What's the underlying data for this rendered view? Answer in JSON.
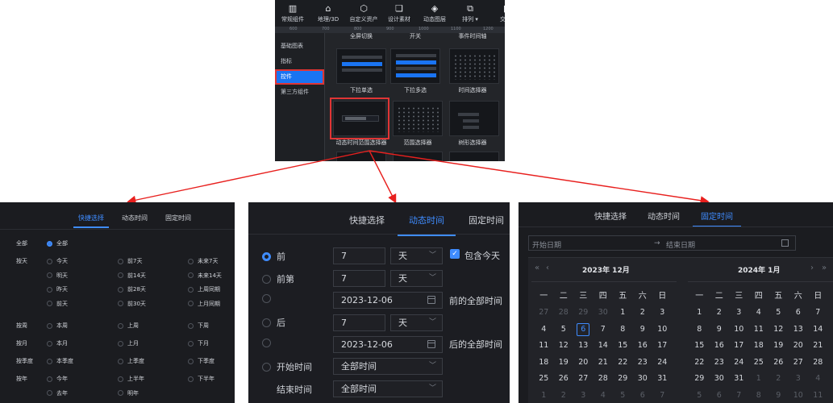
{
  "picker": {
    "toolbar": [
      {
        "label": "常规组件",
        "icon": "chart-icon",
        "glyph": "▥"
      },
      {
        "label": "地理/3D",
        "icon": "map-pin-icon",
        "glyph": "⌂"
      },
      {
        "label": "自定义资产",
        "icon": "hexagon-icon",
        "glyph": "⬡"
      },
      {
        "label": "设计素材",
        "icon": "puzzle-icon",
        "glyph": "❏"
      },
      {
        "label": "动态图层",
        "icon": "layers-icon",
        "glyph": "◈"
      },
      {
        "label": "排列 ▾",
        "icon": "arrange-icon",
        "glyph": "⧉"
      },
      {
        "label": "交互",
        "icon": "interaction-icon",
        "glyph": "▮"
      }
    ],
    "ruler": [
      "600",
      "700",
      "800",
      "900",
      "1000",
      "1100",
      "1200"
    ],
    "sidebar": [
      "基础图表",
      "指标",
      "控件",
      "第三方组件"
    ],
    "sidebar_active": "控件",
    "row1_labels": [
      "全屏切换",
      "开关",
      "事件时间轴"
    ],
    "row2_labels": [
      "下拉单选",
      "下拉多选",
      "时间选择器"
    ],
    "row3_labels": [
      "动态时间范围选择器",
      "范围选择器",
      "树形选择器"
    ],
    "selected": "动态时间范围选择器"
  },
  "quick": {
    "tabs": [
      "快捷选择",
      "动态时间",
      "固定时间"
    ],
    "active_tab": "快捷选择",
    "all_label": "全部",
    "all_option": "全部",
    "rows": [
      {
        "label": "按天",
        "options": [
          [
            "今天",
            "前7天",
            "未来7天"
          ],
          [
            "明天",
            "前14天",
            "未来14天"
          ],
          [
            "昨天",
            "前28天",
            "上周同期"
          ],
          [
            "前天",
            "前30天",
            "上月同期"
          ]
        ]
      },
      {
        "label": "按周",
        "options": [
          [
            "本周",
            "上周",
            "下周"
          ]
        ]
      },
      {
        "label": "按月",
        "options": [
          [
            "本月",
            "上月",
            "下月"
          ]
        ]
      },
      {
        "label": "按季度",
        "options": [
          [
            "本季度",
            "上季度",
            "下季度"
          ]
        ]
      },
      {
        "label": "按年",
        "options": [
          [
            "今年",
            "上半年",
            "下半年"
          ],
          [
            "去年",
            "明年",
            ""
          ]
        ]
      }
    ]
  },
  "dynamic": {
    "tabs": [
      "快捷选择",
      "动态时间",
      "固定时间"
    ],
    "active_tab": "动态时间",
    "include_today": "包含今天",
    "rows": [
      {
        "radio": "前",
        "checked": true,
        "value": "7",
        "unit": "天"
      },
      {
        "radio": "前第",
        "checked": false,
        "value": "7",
        "unit": "天"
      },
      {
        "radio": "",
        "checked": false,
        "date": "2023-12-06",
        "note": "前的全部时间"
      },
      {
        "radio": "后",
        "checked": false,
        "value": "7",
        "unit": "天"
      },
      {
        "radio": "",
        "checked": false,
        "date": "2023-12-06",
        "note": "后的全部时间"
      },
      {
        "radio": "开始时间",
        "checked": false,
        "select": "全部时间"
      },
      {
        "radio": "结束时间",
        "select": "全部时间"
      }
    ]
  },
  "fixed": {
    "tabs": [
      "快捷选择",
      "动态时间",
      "固定时间"
    ],
    "active_tab": "固定时间",
    "start_placeholder": "开始日期",
    "end_placeholder": "结束日期",
    "range_sep": "→",
    "left_title": "2023年  12月",
    "right_title": "2024年  1月",
    "weekdays": [
      "一",
      "二",
      "三",
      "四",
      "五",
      "六",
      "日"
    ],
    "left_days": [
      [
        "27",
        "28",
        "29",
        "30",
        "1",
        "2",
        "3"
      ],
      [
        "4",
        "5",
        "6",
        "7",
        "8",
        "9",
        "10"
      ],
      [
        "11",
        "12",
        "13",
        "14",
        "15",
        "16",
        "17"
      ],
      [
        "18",
        "19",
        "20",
        "21",
        "22",
        "23",
        "24"
      ],
      [
        "25",
        "26",
        "27",
        "28",
        "29",
        "30",
        "31"
      ],
      [
        "1",
        "2",
        "3",
        "4",
        "5",
        "6",
        "7"
      ]
    ],
    "right_days": [
      [
        "1",
        "2",
        "3",
        "4",
        "5",
        "6",
        "7"
      ],
      [
        "8",
        "9",
        "10",
        "11",
        "12",
        "13",
        "14"
      ],
      [
        "15",
        "16",
        "17",
        "18",
        "19",
        "20",
        "21"
      ],
      [
        "22",
        "23",
        "24",
        "25",
        "26",
        "27",
        "28"
      ],
      [
        "29",
        "30",
        "31",
        "1",
        "2",
        "3",
        "4"
      ],
      [
        "5",
        "6",
        "7",
        "8",
        "9",
        "10",
        "11"
      ]
    ],
    "today": "6",
    "accent": "#3f8cff"
  }
}
